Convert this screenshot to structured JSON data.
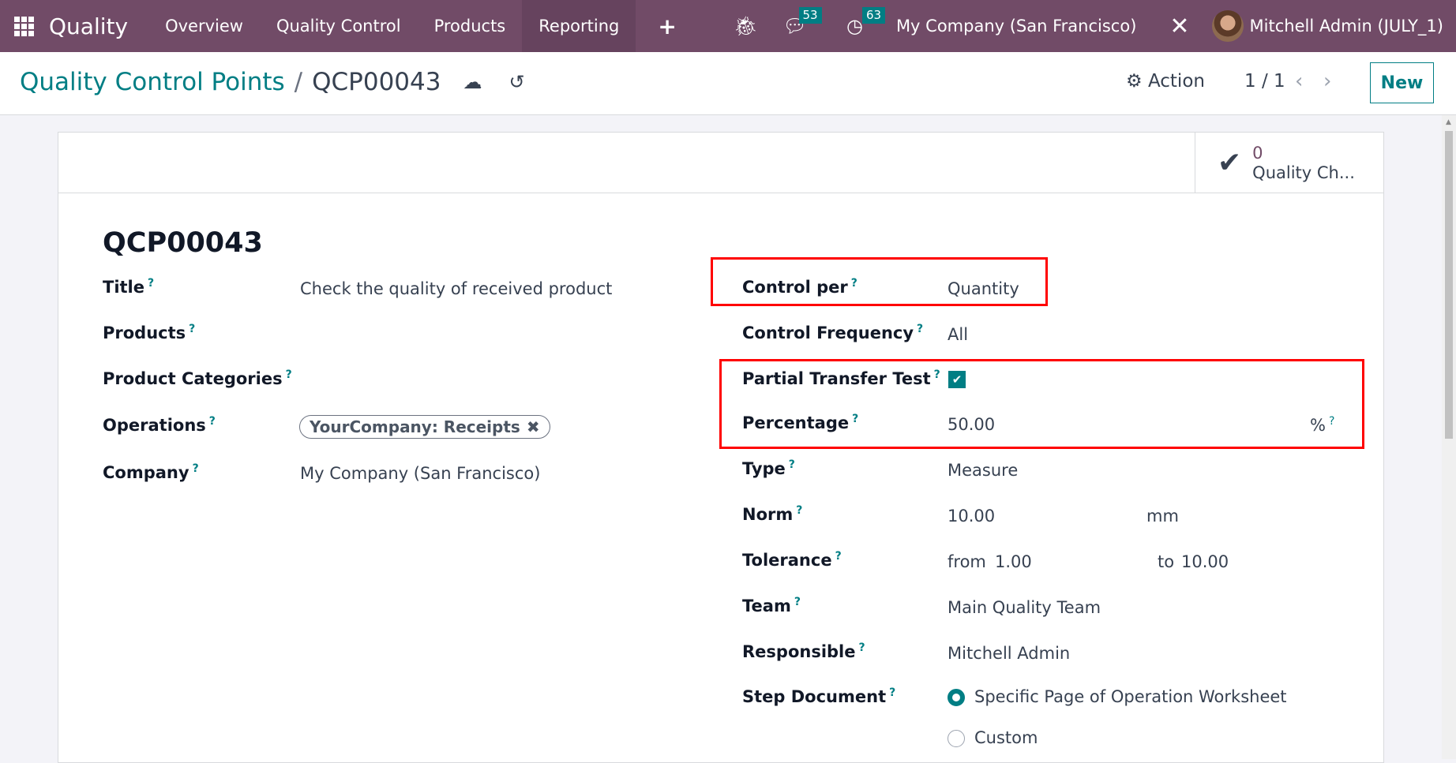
{
  "navbar": {
    "app_name": "Quality",
    "menus": [
      "Overview",
      "Quality Control",
      "Products",
      "Reporting"
    ],
    "active_menu": "Reporting",
    "messages_count": "53",
    "activities_count": "63",
    "company": "My Company (San Francisco)",
    "user": "Mitchell Admin (JULY_1)"
  },
  "control_panel": {
    "breadcrumb_parent": "Quality Control Points",
    "breadcrumb_sep": "/",
    "breadcrumb_current": "QCP00043",
    "action_label": "Action",
    "pager": "1 / 1",
    "new_label": "New"
  },
  "smart_button": {
    "count": "0",
    "label": "Quality Ch..."
  },
  "form": {
    "reference": "QCP00043",
    "left": {
      "title_label": "Title",
      "title_value": "Check the quality of received product",
      "products_label": "Products",
      "product_categories_label": "Product Categories",
      "operations_label": "Operations",
      "operations_tag": "YourCompany: Receipts",
      "company_label": "Company",
      "company_value": "My Company (San Francisco)"
    },
    "right": {
      "control_per_label": "Control per",
      "control_per_value": "Quantity",
      "control_frequency_label": "Control Frequency",
      "control_frequency_value": "All",
      "partial_transfer_label": "Partial Transfer Test",
      "partial_transfer_checked": true,
      "percentage_label": "Percentage",
      "percentage_value": "50.00",
      "percentage_unit": "%",
      "type_label": "Type",
      "type_value": "Measure",
      "norm_label": "Norm",
      "norm_value": "10.00",
      "norm_unit": "mm",
      "tolerance_label": "Tolerance",
      "tolerance_from_label": "from",
      "tolerance_from": "1.00",
      "tolerance_to_label": "to",
      "tolerance_to": "10.00",
      "team_label": "Team",
      "team_value": "Main Quality Team",
      "responsible_label": "Responsible",
      "responsible_value": "Mitchell Admin",
      "step_document_label": "Step Document",
      "step_document_options": [
        "Specific Page of Operation Worksheet",
        "Custom"
      ],
      "step_document_selected": "Specific Page of Operation Worksheet"
    },
    "help_mark": "?"
  },
  "colors": {
    "brand": "#714b67",
    "accent": "#017e84",
    "highlight": "#ff0000"
  }
}
